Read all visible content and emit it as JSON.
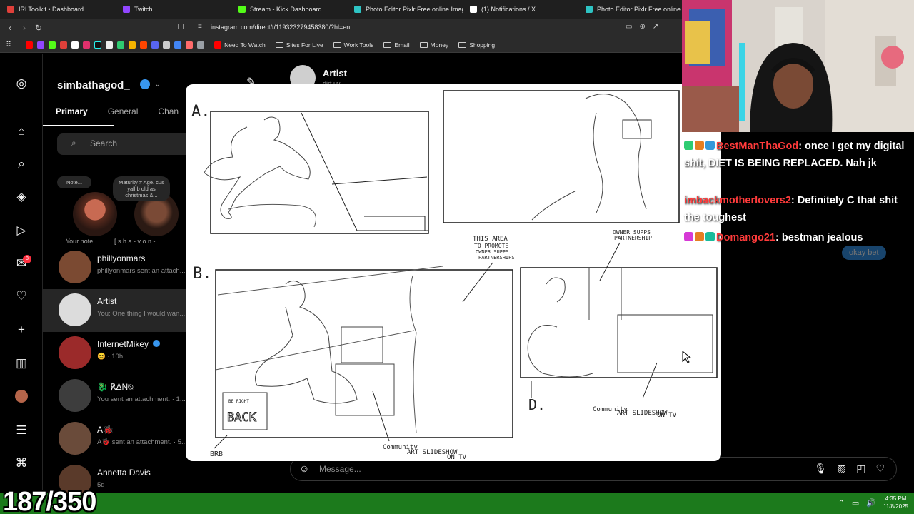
{
  "browser": {
    "tabs": [
      {
        "title": "IRLToolkit • Dashboard",
        "color": "#e0403a"
      },
      {
        "title": "Twitch",
        "color": "#9146ff"
      },
      {
        "title": "Stream - Kick Dashboard",
        "color": "#53fc18"
      },
      {
        "title": "Photo Editor Pixlr Free online Image",
        "color": "#2ec4c4"
      },
      {
        "title": "(1) Notifications / X",
        "color": "#ffffff"
      },
      {
        "title": "Photo Editor Pixlr Free online Ima",
        "color": "#2ec4c4"
      }
    ],
    "url": "instagram.com/direct/t/119323279458380/?hl=en",
    "bookmark_folders": [
      "Need To Watch",
      "Sites For Live",
      "Work Tools",
      "Email",
      "Money",
      "Shopping"
    ]
  },
  "instagram": {
    "username": "simbathagod_",
    "tabs": [
      "Primary",
      "General",
      "Chan"
    ],
    "search_placeholder": "Search",
    "notes": {
      "note_placeholder": "Note...",
      "bubble2": "Maturity ≠ Age. cus yall b old as christmas &...",
      "your_note": "Your note",
      "user2": "[ s h a - v o n - ..."
    },
    "conversations": [
      {
        "name": "phillyonmars",
        "sub": "phillyonmars sent an attach..."
      },
      {
        "name": "Artist",
        "sub": "You: One thing I would wan..."
      },
      {
        "name": "InternetMikey",
        "sub": "😊 · 10h"
      },
      {
        "name": "🐉 ℟ΔΝ⍉",
        "sub": "You sent an attachment. · 1..."
      },
      {
        "name": "A🐞",
        "sub": "A🐞 sent an attachment. · 5..."
      },
      {
        "name": "Annetta Davis",
        "sub": "5d"
      }
    ],
    "notification_badge": "8",
    "chat": {
      "name": "Artist",
      "sub": "dirt.uv",
      "message_placeholder": "Message...",
      "bubble": "okay bet"
    }
  },
  "sketch": {
    "labels": {
      "a": "A.",
      "b": "B.",
      "d": "D.",
      "brb": "BRB",
      "promote": [
        "THIS AREA",
        "TO PROMOTE",
        "OWNER SUPPS",
        "PARTNERSHIPS"
      ],
      "owner": [
        "OWNER SUPPS",
        "PARTNERSHIP"
      ],
      "community1": [
        "Community",
        "ART SLIDESHOW",
        "ON TV"
      ],
      "community2": [
        "Community",
        "ART SLIDESHOW",
        "ON TV"
      ],
      "sign": [
        "BE RIGHT",
        "BACK"
      ]
    }
  },
  "stream_chat": [
    {
      "user": "BestManThaGod",
      "msg": ": once I get my digital shit, DIET IS BEING REPLACED. Nah jk"
    },
    {
      "user": "imbackmotherlovers2",
      "msg": ": Definitely C that shit the toughest"
    },
    {
      "user": "Domango21",
      "msg": ": bestman jealous"
    }
  ],
  "overlay": {
    "counter": "187/350"
  },
  "taskbar": {
    "time": "4:35 PM",
    "date": "11/8/2025"
  }
}
